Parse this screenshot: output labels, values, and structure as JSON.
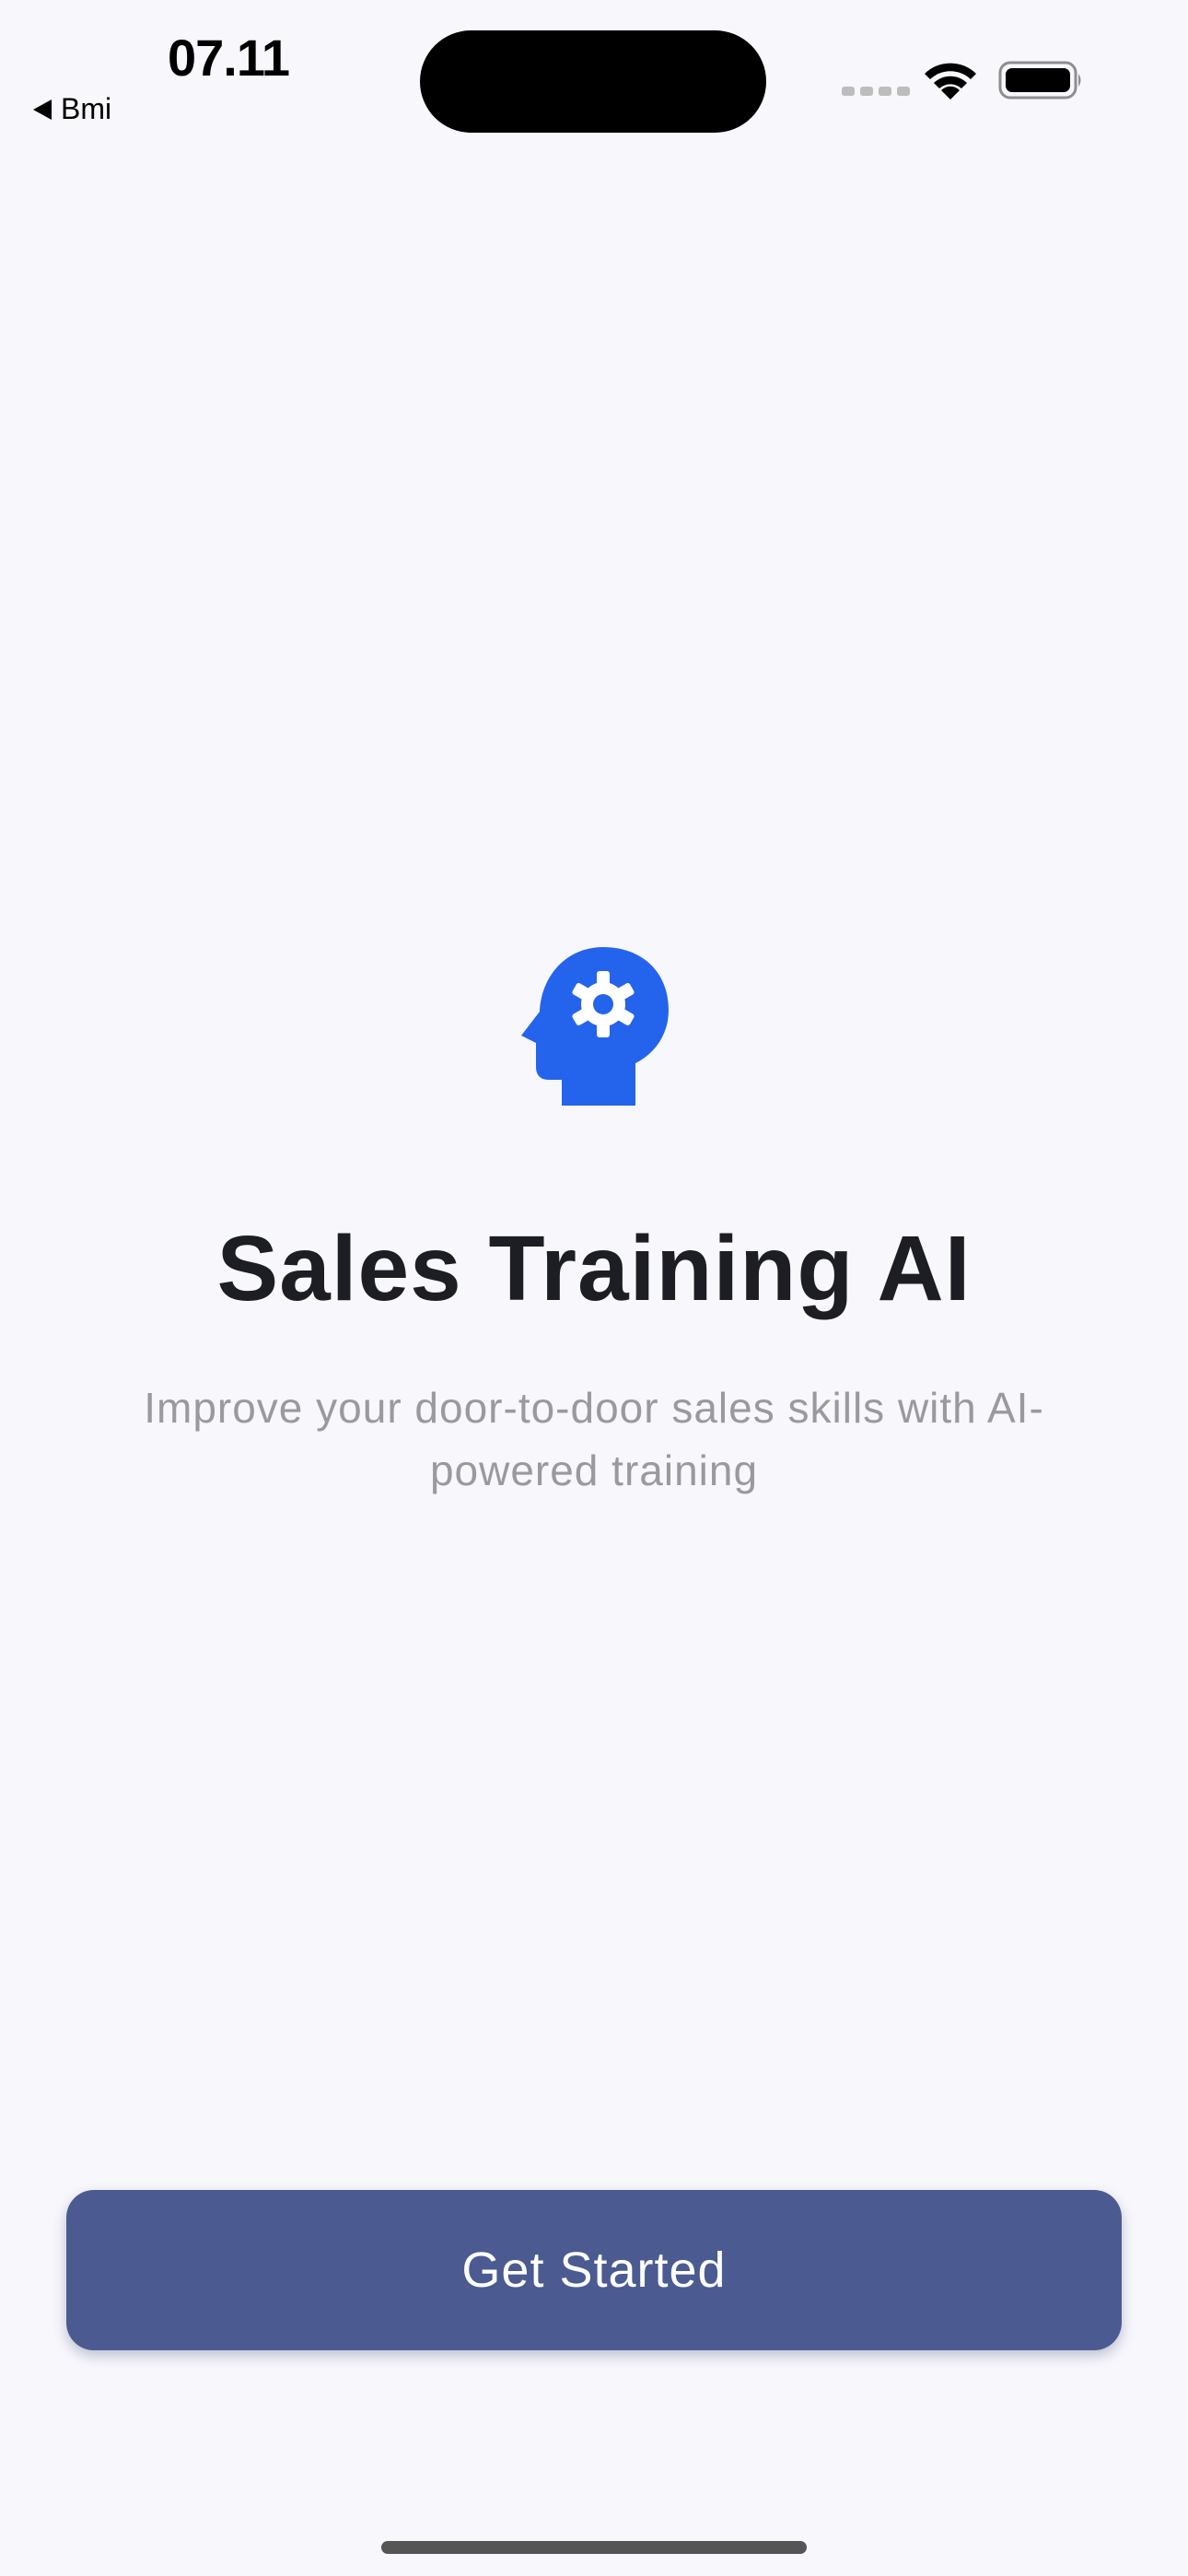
{
  "status_bar": {
    "time": "07.11",
    "back_label": "Bmi"
  },
  "icons": {
    "wifi": "wifi-icon",
    "battery": "battery-icon",
    "app": "head-gear-icon",
    "back": "back-triangle-icon"
  },
  "welcome": {
    "title": "Sales Training AI",
    "subtitle": "Improve your door-to-door sales skills with AI-powered training"
  },
  "actions": {
    "get_started_label": "Get Started"
  },
  "colors": {
    "background": "#f7f7fc",
    "accent": "#2463eb",
    "button": "#4b5b91",
    "title": "#1d1d24",
    "subtitle": "#9a9a9e"
  }
}
